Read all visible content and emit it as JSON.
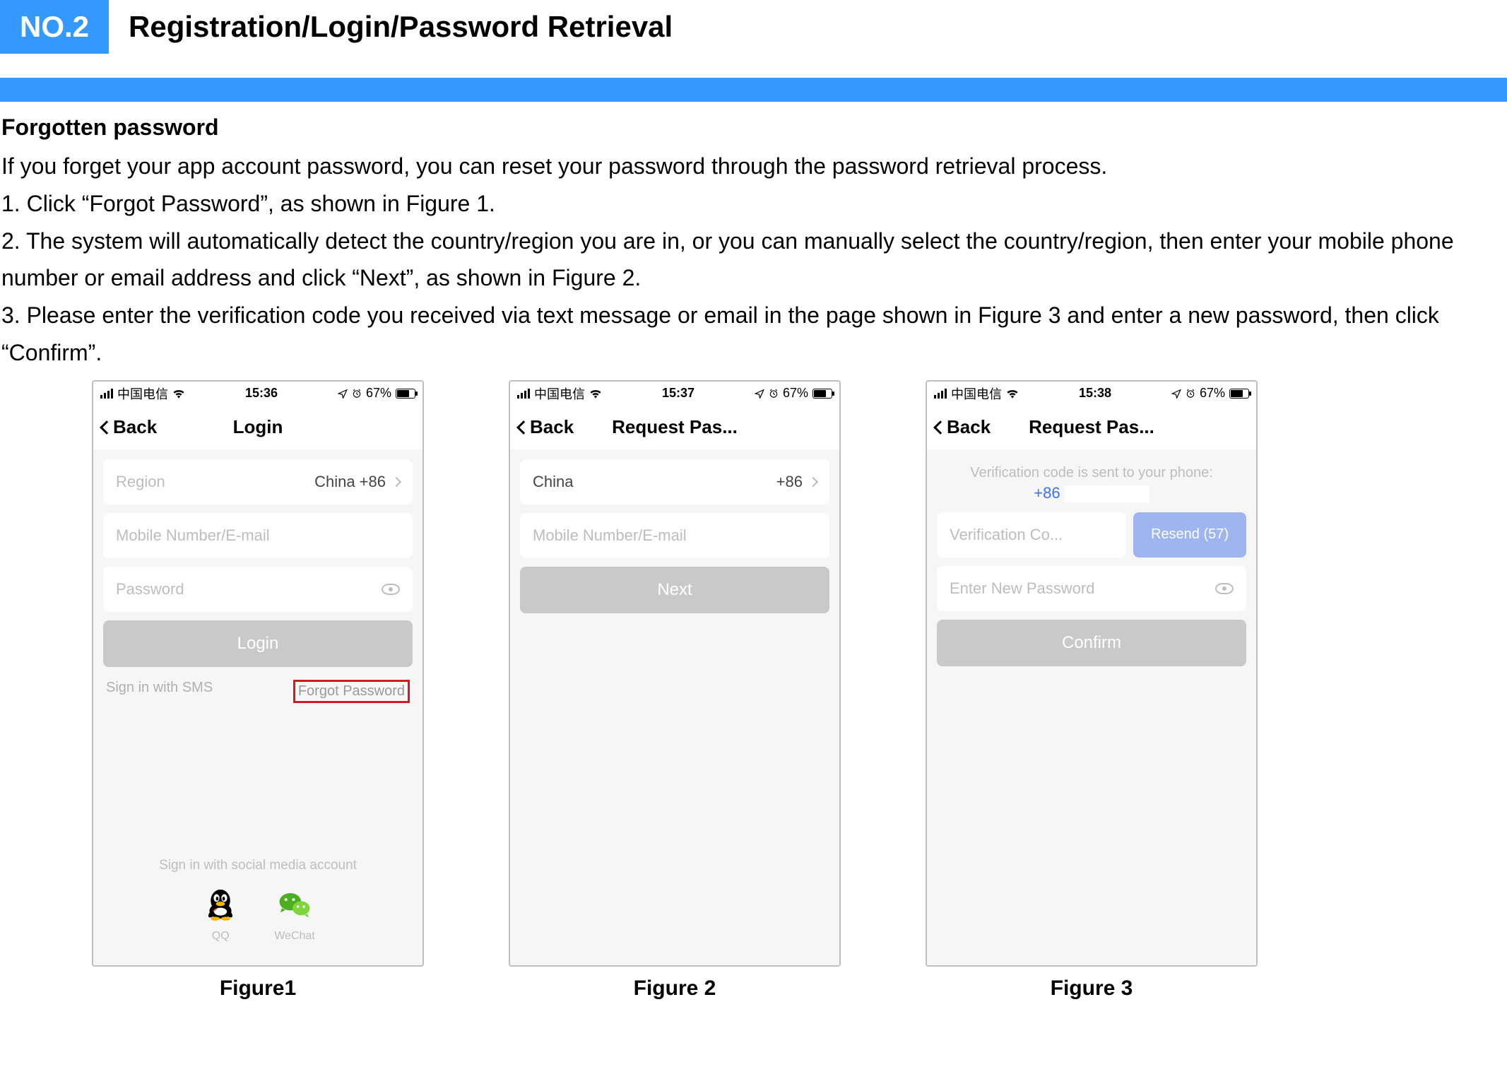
{
  "header": {
    "badge": "NO.2",
    "title": "Registration/Login/Password Retrieval"
  },
  "body": {
    "subhead": "Forgotten password",
    "p1": "If you forget your app account password, you can reset your password through the password retrieval process.",
    "p2": "1. Click “Forgot Password”, as shown in Figure 1.",
    "p3": "2. The system will automatically detect the country/region you are in, or you can manually select the country/region, then enter your mobile phone number or email address and click “Next”, as shown in Figure 2.",
    "p4": "3. Please enter the verification code you received via text message or email in the page shown in Figure 3 and enter a new password, then click “Confirm”."
  },
  "captions": {
    "f1": "Figure1",
    "f2": "Figure 2",
    "f3": "Figure 3"
  },
  "status": {
    "carrier": "中国电信",
    "battery": "67%",
    "t1": "15:36",
    "t2": "15:37",
    "t3": "15:38",
    "loc": "➤",
    "alarm": "⏰"
  },
  "fig1": {
    "back": "Back",
    "title": "Login",
    "region_label": "Region",
    "region_value": "China +86",
    "mobile_ph": "Mobile Number/E-mail",
    "password_ph": "Password",
    "login_btn": "Login",
    "sms_link": "Sign in with SMS",
    "forgot_link": "Forgot Password",
    "social_title": "Sign in with social media account",
    "qq": "QQ",
    "wechat": "WeChat"
  },
  "fig2": {
    "back": "Back",
    "title": "Request Pas...",
    "country": "China",
    "code": "+86",
    "mobile_ph": "Mobile Number/E-mail",
    "next_btn": "Next"
  },
  "fig3": {
    "back": "Back",
    "title": "Request Pas...",
    "sent_text": "Verification code is sent to your phone:",
    "sent_num_prefix": "+86",
    "verif_ph": "Verification Co...",
    "resend": "Resend (57)",
    "newpw_ph": "Enter New Password",
    "confirm_btn": "Confirm"
  },
  "icons": {
    "nav_arrow": "➤",
    "alarm": "⦿"
  }
}
